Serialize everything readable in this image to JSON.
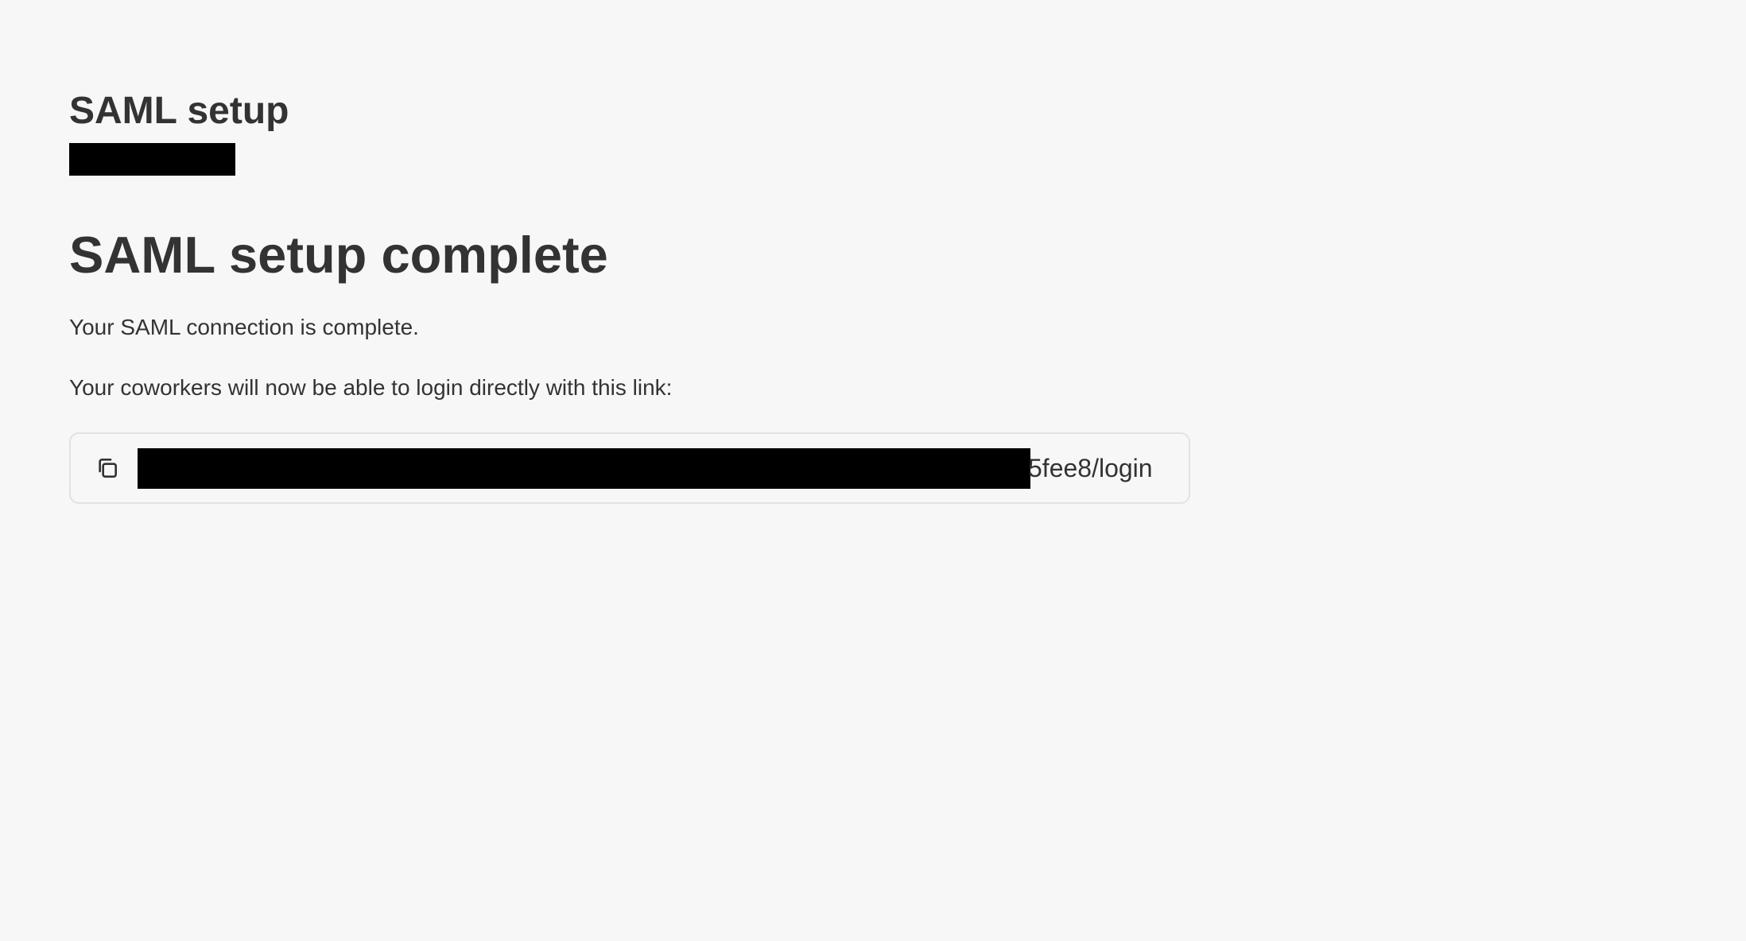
{
  "header": {
    "title": "SAML setup"
  },
  "main": {
    "heading": "SAML setup complete",
    "paragraph1": "Your SAML connection is complete.",
    "paragraph2": "Your coworkers will now be able to login directly with this link:",
    "link": {
      "visible_suffix": "5fee8/login",
      "copy_icon": "copy-icon"
    }
  },
  "colors": {
    "background": "#f7f7f7",
    "text": "#333333",
    "border": "#e2e2e2",
    "redaction": "#000000"
  }
}
